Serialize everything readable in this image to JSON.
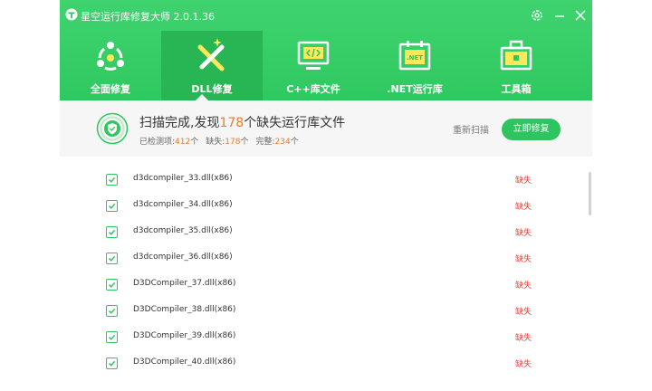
{
  "app": {
    "title": "星空运行库修复大师 2.0.1.36"
  },
  "nav": {
    "tabs": [
      {
        "label": "全面修复"
      },
      {
        "label": "DLL修复"
      },
      {
        "label": "C++库文件"
      },
      {
        "label": ".NET运行库"
      },
      {
        "label": "工具箱"
      }
    ],
    "active_index": 1,
    "net_badge": ".NET"
  },
  "summary": {
    "title_prefix": "扫描完成,发现",
    "missing_count": "178",
    "title_suffix": "个缺失运行库文件",
    "detected_label": "已检测项:",
    "detected_count": "412",
    "missing_label": "缺失:",
    "missing_count_small": "178",
    "complete_label": "完整:",
    "complete_count": "234",
    "unit": "个",
    "rescan_label": "重新扫描",
    "fix_label": "立即修复"
  },
  "files": [
    {
      "name": "d3dcompiler_33.dll(x86)",
      "status": "缺失"
    },
    {
      "name": "d3dcompiler_34.dll(x86)",
      "status": "缺失"
    },
    {
      "name": "d3dcompiler_35.dll(x86)",
      "status": "缺失"
    },
    {
      "name": "d3dcompiler_36.dll(x86)",
      "status": "缺失"
    },
    {
      "name": "D3DCompiler_37.dll(x86)",
      "status": "缺失"
    },
    {
      "name": "D3DCompiler_38.dll(x86)",
      "status": "缺失"
    },
    {
      "name": "D3DCompiler_39.dll(x86)",
      "status": "缺失"
    },
    {
      "name": "D3DCompiler_40.dll(x86)",
      "status": "缺失"
    }
  ],
  "colors": {
    "brand_green": "#2fc860",
    "active_tab": "#27b653",
    "count_orange": "#f07a2a",
    "missing_red": "#e8403a"
  },
  "icons": {
    "titlebar": [
      "app-logo-icon",
      "settings-icon",
      "minimize-icon",
      "close-icon"
    ],
    "tabs": [
      "refresh-cycle-icon",
      "dll-tools-icon",
      "code-monitor-icon",
      "net-calendar-icon",
      "toolbox-icon"
    ],
    "summary": "shield-check-icon",
    "row": "checkbox-checked-icon"
  }
}
